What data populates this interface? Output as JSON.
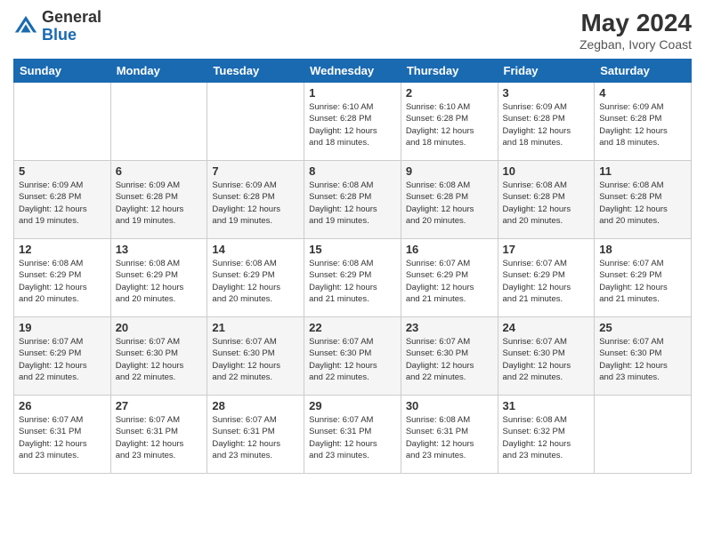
{
  "header": {
    "logo_general": "General",
    "logo_blue": "Blue",
    "month_year": "May 2024",
    "location": "Zegban, Ivory Coast"
  },
  "weekdays": [
    "Sunday",
    "Monday",
    "Tuesday",
    "Wednesday",
    "Thursday",
    "Friday",
    "Saturday"
  ],
  "weeks": [
    [
      {
        "day": "",
        "info": ""
      },
      {
        "day": "",
        "info": ""
      },
      {
        "day": "",
        "info": ""
      },
      {
        "day": "1",
        "info": "Sunrise: 6:10 AM\nSunset: 6:28 PM\nDaylight: 12 hours\nand 18 minutes."
      },
      {
        "day": "2",
        "info": "Sunrise: 6:10 AM\nSunset: 6:28 PM\nDaylight: 12 hours\nand 18 minutes."
      },
      {
        "day": "3",
        "info": "Sunrise: 6:09 AM\nSunset: 6:28 PM\nDaylight: 12 hours\nand 18 minutes."
      },
      {
        "day": "4",
        "info": "Sunrise: 6:09 AM\nSunset: 6:28 PM\nDaylight: 12 hours\nand 18 minutes."
      }
    ],
    [
      {
        "day": "5",
        "info": "Sunrise: 6:09 AM\nSunset: 6:28 PM\nDaylight: 12 hours\nand 19 minutes."
      },
      {
        "day": "6",
        "info": "Sunrise: 6:09 AM\nSunset: 6:28 PM\nDaylight: 12 hours\nand 19 minutes."
      },
      {
        "day": "7",
        "info": "Sunrise: 6:09 AM\nSunset: 6:28 PM\nDaylight: 12 hours\nand 19 minutes."
      },
      {
        "day": "8",
        "info": "Sunrise: 6:08 AM\nSunset: 6:28 PM\nDaylight: 12 hours\nand 19 minutes."
      },
      {
        "day": "9",
        "info": "Sunrise: 6:08 AM\nSunset: 6:28 PM\nDaylight: 12 hours\nand 20 minutes."
      },
      {
        "day": "10",
        "info": "Sunrise: 6:08 AM\nSunset: 6:28 PM\nDaylight: 12 hours\nand 20 minutes."
      },
      {
        "day": "11",
        "info": "Sunrise: 6:08 AM\nSunset: 6:28 PM\nDaylight: 12 hours\nand 20 minutes."
      }
    ],
    [
      {
        "day": "12",
        "info": "Sunrise: 6:08 AM\nSunset: 6:29 PM\nDaylight: 12 hours\nand 20 minutes."
      },
      {
        "day": "13",
        "info": "Sunrise: 6:08 AM\nSunset: 6:29 PM\nDaylight: 12 hours\nand 20 minutes."
      },
      {
        "day": "14",
        "info": "Sunrise: 6:08 AM\nSunset: 6:29 PM\nDaylight: 12 hours\nand 20 minutes."
      },
      {
        "day": "15",
        "info": "Sunrise: 6:08 AM\nSunset: 6:29 PM\nDaylight: 12 hours\nand 21 minutes."
      },
      {
        "day": "16",
        "info": "Sunrise: 6:07 AM\nSunset: 6:29 PM\nDaylight: 12 hours\nand 21 minutes."
      },
      {
        "day": "17",
        "info": "Sunrise: 6:07 AM\nSunset: 6:29 PM\nDaylight: 12 hours\nand 21 minutes."
      },
      {
        "day": "18",
        "info": "Sunrise: 6:07 AM\nSunset: 6:29 PM\nDaylight: 12 hours\nand 21 minutes."
      }
    ],
    [
      {
        "day": "19",
        "info": "Sunrise: 6:07 AM\nSunset: 6:29 PM\nDaylight: 12 hours\nand 22 minutes."
      },
      {
        "day": "20",
        "info": "Sunrise: 6:07 AM\nSunset: 6:30 PM\nDaylight: 12 hours\nand 22 minutes."
      },
      {
        "day": "21",
        "info": "Sunrise: 6:07 AM\nSunset: 6:30 PM\nDaylight: 12 hours\nand 22 minutes."
      },
      {
        "day": "22",
        "info": "Sunrise: 6:07 AM\nSunset: 6:30 PM\nDaylight: 12 hours\nand 22 minutes."
      },
      {
        "day": "23",
        "info": "Sunrise: 6:07 AM\nSunset: 6:30 PM\nDaylight: 12 hours\nand 22 minutes."
      },
      {
        "day": "24",
        "info": "Sunrise: 6:07 AM\nSunset: 6:30 PM\nDaylight: 12 hours\nand 22 minutes."
      },
      {
        "day": "25",
        "info": "Sunrise: 6:07 AM\nSunset: 6:30 PM\nDaylight: 12 hours\nand 23 minutes."
      }
    ],
    [
      {
        "day": "26",
        "info": "Sunrise: 6:07 AM\nSunset: 6:31 PM\nDaylight: 12 hours\nand 23 minutes."
      },
      {
        "day": "27",
        "info": "Sunrise: 6:07 AM\nSunset: 6:31 PM\nDaylight: 12 hours\nand 23 minutes."
      },
      {
        "day": "28",
        "info": "Sunrise: 6:07 AM\nSunset: 6:31 PM\nDaylight: 12 hours\nand 23 minutes."
      },
      {
        "day": "29",
        "info": "Sunrise: 6:07 AM\nSunset: 6:31 PM\nDaylight: 12 hours\nand 23 minutes."
      },
      {
        "day": "30",
        "info": "Sunrise: 6:08 AM\nSunset: 6:31 PM\nDaylight: 12 hours\nand 23 minutes."
      },
      {
        "day": "31",
        "info": "Sunrise: 6:08 AM\nSunset: 6:32 PM\nDaylight: 12 hours\nand 23 minutes."
      },
      {
        "day": "",
        "info": ""
      }
    ]
  ]
}
